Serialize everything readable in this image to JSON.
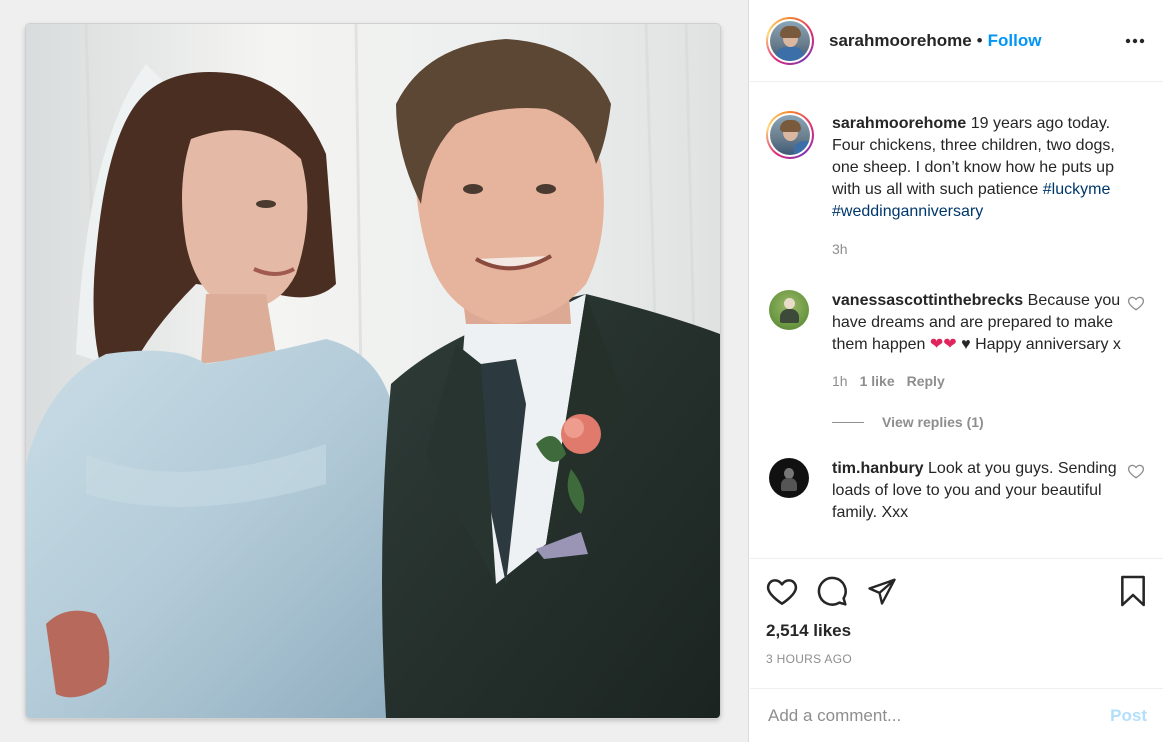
{
  "post": {
    "image_alt": "Wedding photo of a bride and groom",
    "author": {
      "username": "sarahmoorehome",
      "follow_label": "Follow",
      "separator": "•"
    },
    "caption": {
      "username": "sarahmoorehome",
      "text": "19 years ago today. Four chickens, three children, two dogs, one sheep. I don’t know how he puts up with us all with such patience",
      "hashtags": [
        "#luckyme",
        "#weddinganniversary"
      ],
      "time": "3h"
    },
    "comments": [
      {
        "username": "vanessascottinthebrecks",
        "text": "Because you have dreams and are prepared to make them happen",
        "emoji_line": "❤️❤️ ♥ Happy anniversary x",
        "emoji": "❤",
        "small_heart": "♥",
        "line_end": "Happy anniversary x",
        "time": "1h",
        "likes": "1 like",
        "reply_label": "Reply",
        "view_replies": "View replies (1)"
      },
      {
        "username": "tim.hanbury",
        "text": "Look at you guys. Sending loads of love to you and your beautiful family. Xxx"
      }
    ],
    "likes_count": "2,514 likes",
    "time_ago": "3 HOURS AGO",
    "add_comment_placeholder": "Add a comment...",
    "post_label": "Post"
  },
  "colors": {
    "link_blue": "#0095f6",
    "hashtag": "#00376b",
    "muted": "#8e8e8e",
    "post_disabled": "#b2dffc"
  },
  "icons": [
    "more-icon",
    "heart-icon",
    "comment-icon",
    "share-icon",
    "bookmark-icon",
    "like-comment-icon"
  ]
}
